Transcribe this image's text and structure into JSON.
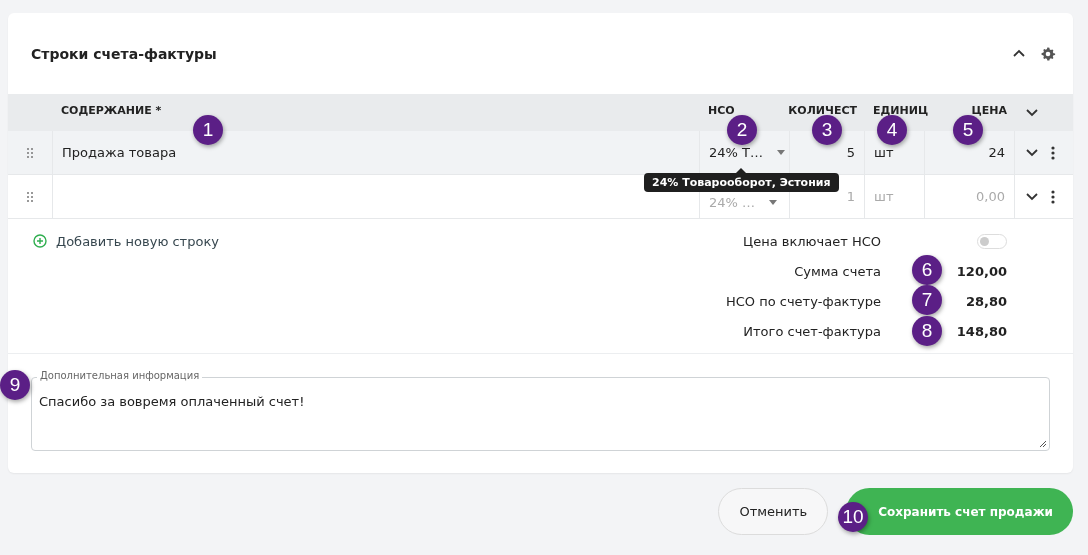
{
  "panel": {
    "title": "Строки счета-фактуры",
    "expanded": true
  },
  "table": {
    "columns": [
      {
        "label": "СОДЕРЖАНИЕ *"
      },
      {
        "label": "НСО"
      },
      {
        "label": "КОЛИЧЕСТ"
      },
      {
        "label": "ЕДИНИЦ"
      },
      {
        "label": "ЦЕНА"
      }
    ],
    "rows": [
      {
        "content": "Продажа товара",
        "tax": "24% Т…",
        "quantity": "5",
        "unit": "шт",
        "price": "24",
        "placeholder": false,
        "highlighted": true
      },
      {
        "content": "",
        "tax": "24% …",
        "quantity": "1",
        "unit": "шт",
        "price": "0,00",
        "placeholder": true,
        "highlighted": false
      }
    ]
  },
  "tooltip": {
    "text": "24% Товарооборот, Эстония"
  },
  "add_row": {
    "label": "Добавить новую строку"
  },
  "price_includes_tax": {
    "label": "Цена включает НСО",
    "on": false
  },
  "totals": [
    {
      "label": "Сумма счета",
      "value": "120,00"
    },
    {
      "label": "НСО по счету-фактуре",
      "value": "28,80"
    },
    {
      "label": "Итого счет-фактура",
      "value": "148,80"
    }
  ],
  "notes": {
    "label": "Дополнительная информация",
    "value": "Спасибо за вовремя оплаченный счет!"
  },
  "buttons": [
    {
      "label": "Отменить",
      "kind": "secondary"
    },
    {
      "label": "Сохранить счет продажи",
      "kind": "primary"
    }
  ],
  "callouts": [
    {
      "label": "1"
    },
    {
      "label": "2"
    },
    {
      "label": "3"
    },
    {
      "label": "4"
    },
    {
      "label": "5"
    },
    {
      "label": "6"
    },
    {
      "label": "7"
    },
    {
      "label": "8"
    },
    {
      "label": "9"
    },
    {
      "label": "10"
    }
  ]
}
